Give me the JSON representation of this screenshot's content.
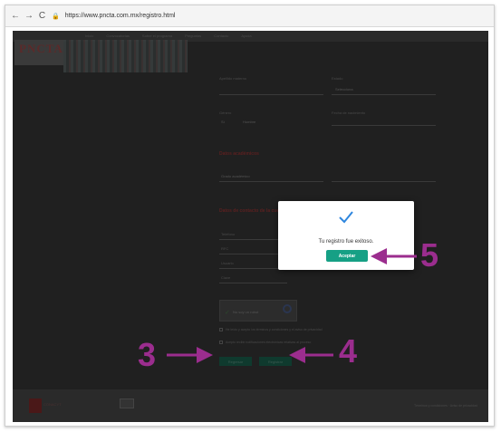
{
  "browser": {
    "back_glyph": "←",
    "forward_glyph": "→",
    "reload_glyph": "C",
    "lock_glyph": "🔒",
    "url": "https://www.pncta.com.mx/registro.html"
  },
  "site": {
    "logo_text": "PNCTA",
    "nav_links": [
      "Inicio",
      "Convocatorias",
      "Sobre el programa",
      "Preguntas",
      "Contacto",
      "Ayuda"
    ],
    "form": {
      "field_labels": [
        "Apellido materno",
        "Estado",
        "Género",
        "Fecha de nacimiento"
      ],
      "gender_options": [
        "Sí",
        "Hombre"
      ],
      "select_value": "Selecciona",
      "section_academic": "Datos académicos",
      "academic_select": "Grado académico",
      "section_contact": "Datos de contacto de la cuenta",
      "contact_labels": [
        "Teléfono",
        "RFC",
        "Usuario",
        "Clave"
      ],
      "recaptcha_label": "No soy un robot",
      "consent_1": "He leído y acepto los términos y condiciones y el aviso de privacidad",
      "consent_2": "Acepto recibir notificaciones electrónicas relativas al proceso",
      "back_button": "Regresar",
      "register_button": "Registrar"
    },
    "footer": {
      "logo_text": "CONACYT",
      "links": "Términos y condiciones · Aviso de privacidad"
    }
  },
  "modal": {
    "check_icon": "check-icon",
    "message": "Tu registro fue exitoso.",
    "button_label": "Aceptar"
  },
  "annotations": {
    "step_3": "3",
    "step_4": "4",
    "step_5": "5",
    "color": "#9b2d8e"
  }
}
